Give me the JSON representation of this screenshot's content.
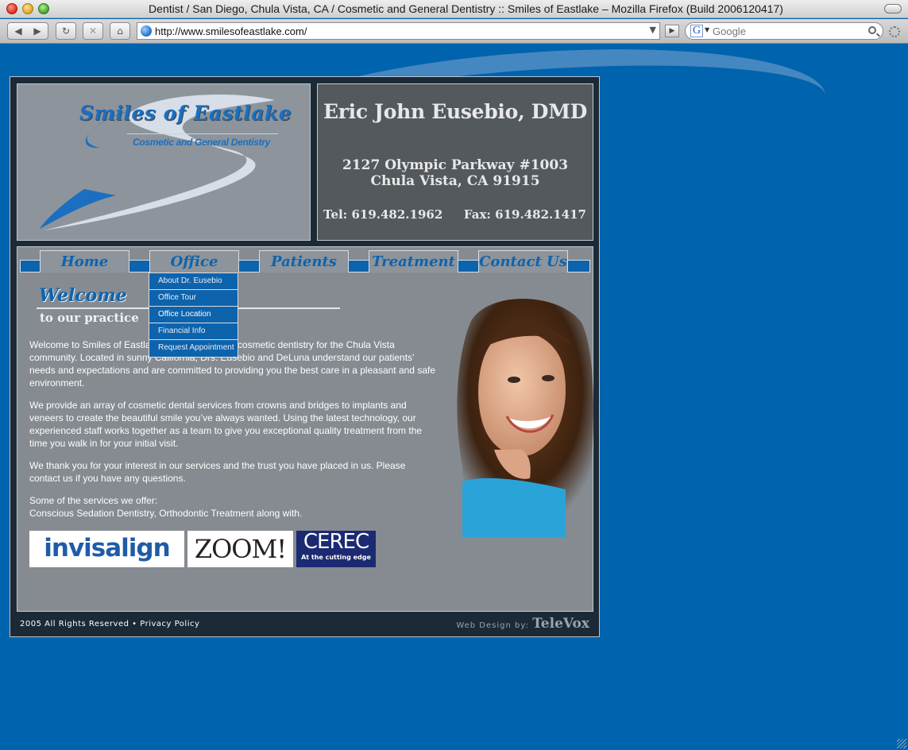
{
  "browser": {
    "window_title": "Dentist / San Diego, Chula Vista, CA / Cosmetic and General Dentistry :: Smiles of Eastlake – Mozilla Firefox (Build 2006120417)",
    "url": "http://www.smilesofeastlake.com/",
    "search_placeholder": "Google",
    "search_engine_glyph": "G"
  },
  "header": {
    "logo_title": "Smiles of Eastlake",
    "logo_subtitle": "Cosmetic and General Dentistry",
    "doctor_name": "Eric John Eusebio, DMD",
    "address_line1": "2127 Olympic Parkway #1003",
    "address_line2": "Chula Vista, CA  91915",
    "tel": "Tel: 619.482.1962",
    "fax": "Fax: 619.482.1417"
  },
  "nav": {
    "tabs": [
      {
        "label": "Home"
      },
      {
        "label": "Office"
      },
      {
        "label": "Patients"
      },
      {
        "label": "Treatment"
      },
      {
        "label": "Contact Us"
      }
    ],
    "office_menu": [
      {
        "label": "About Dr. Eusebio"
      },
      {
        "label": "Office Tour"
      },
      {
        "label": "Office Location"
      },
      {
        "label": "Financial Info"
      },
      {
        "label": "Request Appointment"
      }
    ]
  },
  "content": {
    "welcome_title": "Welcome",
    "welcome_subtitle": "to our practice",
    "paragraphs": [
      "Welcome to Smiles of Eastlake, providing quality cosmetic dentistry for the Chula Vista community. Located in sunny California, Drs. Eusebio and DeLuna understand our patients’ needs and expectations and are committed to providing you the best care in a pleasant and safe environment.",
      "We provide an array of cosmetic dental services from crowns and bridges to implants and veneers to create the beautiful smile you’ve always wanted. Using the latest technology, our experienced staff works together as a team to give you exceptional quality treatment from the time you walk in for your initial visit.",
      "We thank you for your interest in our services and the trust you have placed in us. Please contact us if you have any questions."
    ],
    "services_intro": "Some of the services we offer:",
    "services_list": "Conscious Sedation Dentistry, Orthodontic Treatment along with.",
    "badges": {
      "invisalign": "invisalign",
      "zoom": "ZOOM!",
      "cerec": "CEREC",
      "cerec_tagline": "At the cutting edge"
    }
  },
  "footer": {
    "copyright": "2005 All Rights Reserved",
    "separator": "•",
    "privacy": "Privacy Policy",
    "design_by": "Web Design by:",
    "designer": "TeleVox"
  },
  "colors": {
    "page_bg": "#0063ad",
    "nav_blue": "#0e63ad",
    "panel_gray": "#858b91",
    "info_dark": "#54595e"
  }
}
